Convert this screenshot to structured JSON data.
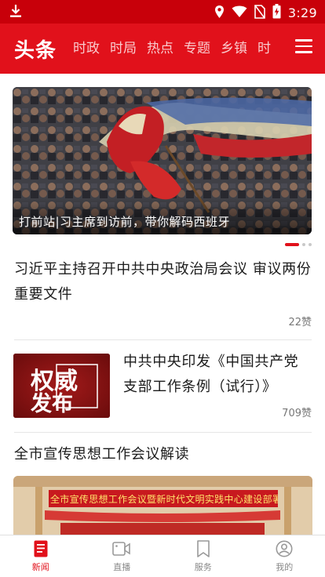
{
  "status_bar": {
    "time": "3:29"
  },
  "header": {
    "app_title": "头条",
    "channels": [
      "时政",
      "时局",
      "热点",
      "专题",
      "乡镇",
      "时"
    ],
    "accent_color": "#e1111b"
  },
  "banner": {
    "caption": "打前站|习主席到访前，带你解码西班牙",
    "page_count": 3,
    "active_page": 1
  },
  "articles": [
    {
      "title": "习近平主持召开中共中央政治局会议 审议两份重要文件",
      "likes": "22赞"
    },
    {
      "title": "中共中央印发《中国共产党支部工作条例（试行）》",
      "likes": "709赞",
      "thumb_text_top": "权威",
      "thumb_text_bottom": "发布"
    },
    {
      "title": "全市宣传思想工作会议解读",
      "banner_text": "全市宣传思想工作会议暨新时代文明实践中心建设部署会"
    }
  ],
  "tab_bar": {
    "items": [
      {
        "label": "新闻",
        "icon": "news-icon",
        "active": true
      },
      {
        "label": "直播",
        "icon": "live-icon",
        "active": false
      },
      {
        "label": "服务",
        "icon": "bookmark-icon",
        "active": false
      },
      {
        "label": "我的",
        "icon": "profile-icon",
        "active": false
      }
    ]
  }
}
